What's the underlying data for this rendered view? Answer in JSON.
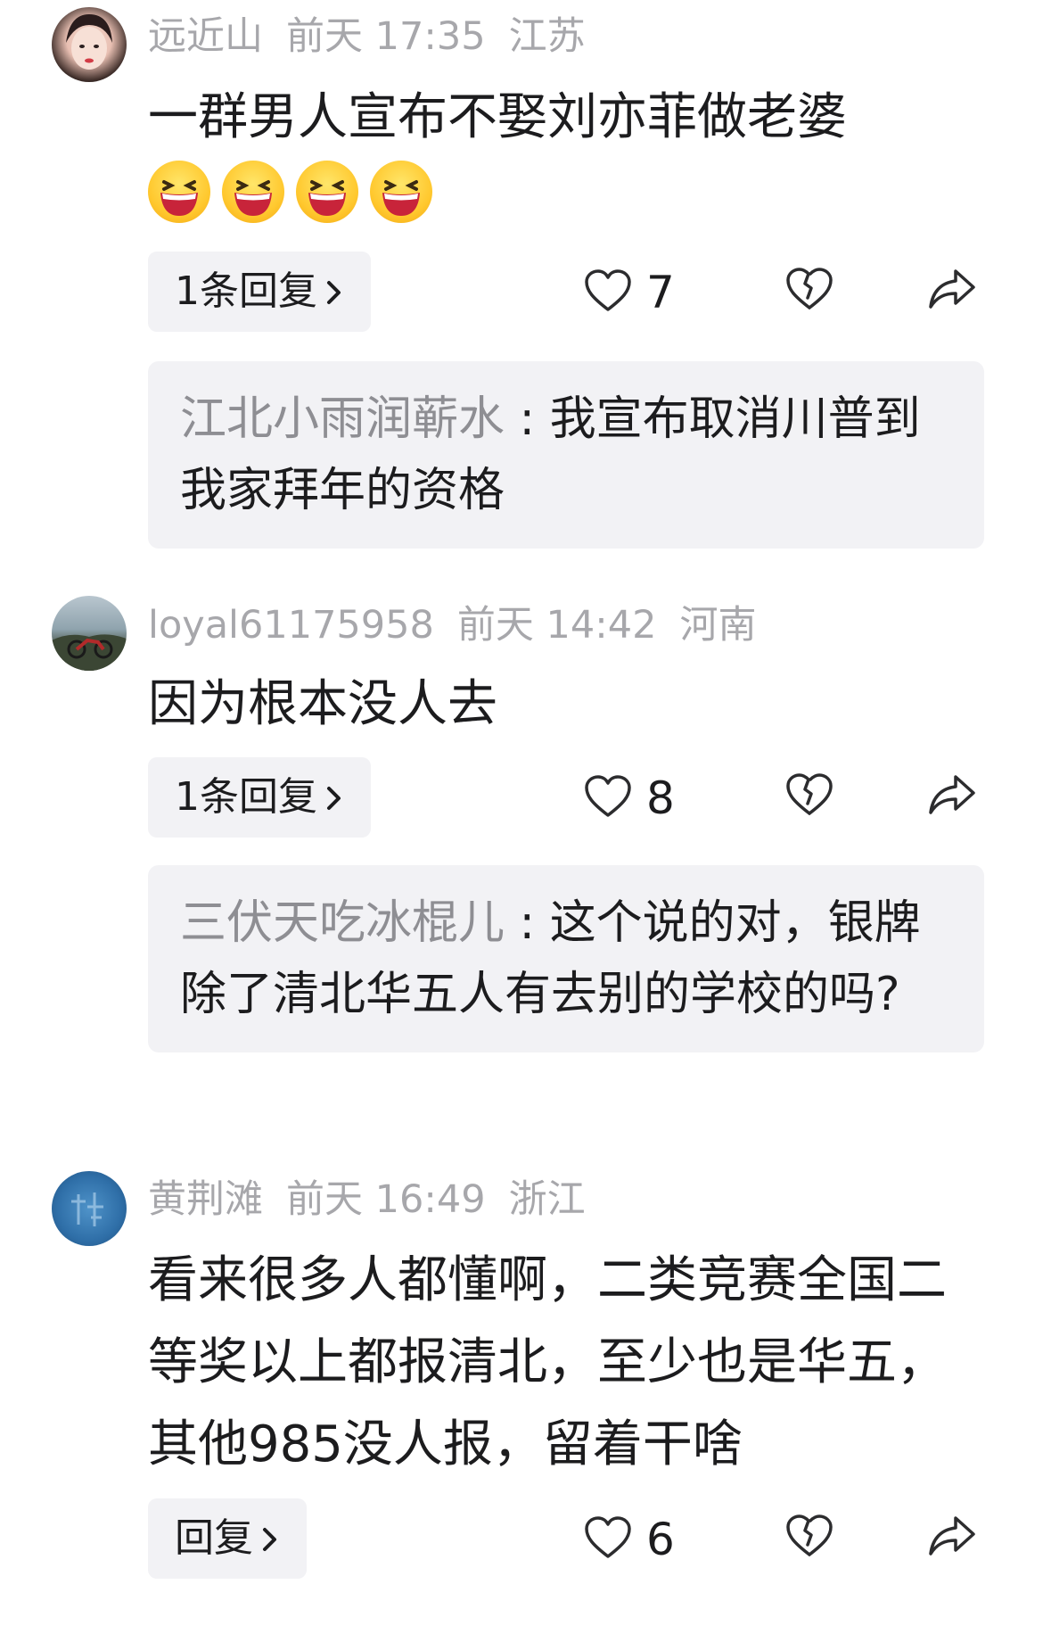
{
  "comments": [
    {
      "user": "远近山",
      "time": "前天 17:35",
      "location": "江苏",
      "text": "一群男人宣布不娶刘亦菲做老婆",
      "emojis": [
        "laughing-emoji",
        "laughing-emoji",
        "laughing-emoji",
        "laughing-emoji"
      ],
      "reply_label": "1条回复",
      "likes": "7",
      "sub_reply": {
        "user": "江北小雨润蕲水",
        "sep": " : ",
        "text": "我宣布取消川普到我家拜年的资格"
      }
    },
    {
      "user": "loyal61175958",
      "time": "前天 14:42",
      "location": "河南",
      "text": "因为根本没人去",
      "reply_label": "1条回复",
      "likes": "8",
      "sub_reply": {
        "user": "三伏天吃冰棍儿",
        "sep": " : ",
        "text": "这个说的对，银牌除了清北华五人有去别的学校的吗?"
      }
    },
    {
      "user": "黄荆滩",
      "time": "前天 16:49",
      "location": "浙江",
      "text": "看来很多人都懂啊，二类竞赛全国二等奖以上都报清北，至少也是华五，其他985没人报，留着干啥",
      "reply_label": "回复",
      "likes": "6"
    }
  ],
  "icons": {
    "like": "heart-outline-icon",
    "dislike": "broken-heart-icon",
    "share": "share-arrow-icon",
    "chevron": "chevron-right-icon"
  },
  "colors": {
    "meta": "#a7a7ab",
    "text": "#1c1c1e",
    "reply_bg": "#f2f2f5"
  }
}
